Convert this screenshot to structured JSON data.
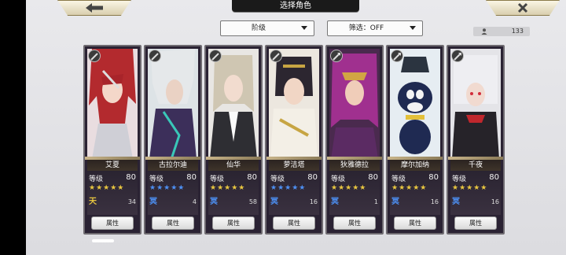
{
  "header": {
    "title": "选择角色",
    "back_icon": "arrow-left-icon",
    "close_icon": "close-x-icon"
  },
  "filters": {
    "sort_label": "阶级",
    "filter_label": "筛选：OFF"
  },
  "count": "133",
  "colors": {
    "gold_star": "#e8c640",
    "blue_star": "#4d8ff2",
    "panel_bg": "#e9e9ec"
  },
  "characters": [
    {
      "name": "艾夏",
      "level_label": "等级",
      "level": "80",
      "stars": "★★★★★",
      "star_color": "gold",
      "rank_glyph": "天",
      "rank_color": "gold",
      "count": "34",
      "attr_label": "属性",
      "weapon_icon": "sword-icon"
    },
    {
      "name": "古拉尔迪",
      "level_label": "等级",
      "level": "80",
      "stars": "★★★★★",
      "star_color": "blue",
      "rank_glyph": "冥",
      "rank_color": "blue",
      "count": "4",
      "attr_label": "属性",
      "weapon_icon": "sword-icon"
    },
    {
      "name": "仙华",
      "level_label": "等级",
      "level": "80",
      "stars": "★★★★★",
      "star_color": "gold",
      "rank_glyph": "冥",
      "rank_color": "blue",
      "count": "58",
      "attr_label": "属性",
      "weapon_icon": "sword-icon"
    },
    {
      "name": "萝洁塔",
      "level_label": "等级",
      "level": "80",
      "stars": "★★★★★",
      "star_color": "blue",
      "rank_glyph": "冥",
      "rank_color": "blue",
      "count": "16",
      "attr_label": "属性",
      "weapon_icon": "sword-icon"
    },
    {
      "name": "狄雅德拉",
      "level_label": "等级",
      "level": "80",
      "stars": "★★★★★",
      "star_color": "gold",
      "rank_glyph": "冥",
      "rank_color": "blue",
      "count": "1",
      "attr_label": "属性",
      "weapon_icon": "axe-icon"
    },
    {
      "name": "摩尔加纳",
      "level_label": "等级",
      "level": "80",
      "stars": "★★★★★",
      "star_color": "gold",
      "rank_glyph": "冥",
      "rank_color": "blue",
      "count": "16",
      "attr_label": "属性",
      "weapon_icon": "axe-icon"
    },
    {
      "name": "千夜",
      "level_label": "等级",
      "level": "80",
      "stars": "★★★★★",
      "star_color": "gold",
      "rank_glyph": "冥",
      "rank_color": "blue",
      "count": "16",
      "attr_label": "属性",
      "weapon_icon": "axe-icon"
    }
  ]
}
